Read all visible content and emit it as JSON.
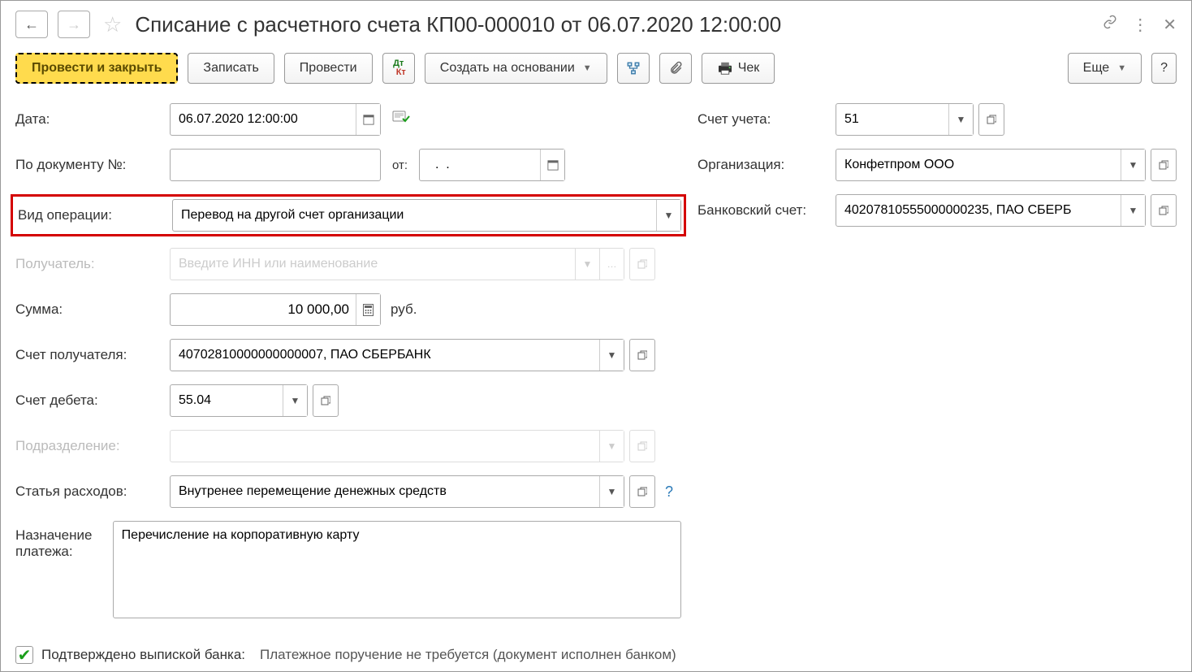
{
  "title": "Списание с расчетного счета КП00-000010 от 06.07.2020 12:00:00",
  "toolbar": {
    "post_close": "Провести и закрыть",
    "save": "Записать",
    "post": "Провести",
    "create_based": "Создать на основании",
    "check": "Чек",
    "more": "Еще",
    "help": "?"
  },
  "labels": {
    "date": "Дата:",
    "doc_no": "По документу №:",
    "from": "от:",
    "operation_type": "Вид операции:",
    "recipient": "Получатель:",
    "amount": "Сумма:",
    "currency": "руб.",
    "recipient_account": "Счет получателя:",
    "debit_account": "Счет дебета:",
    "department": "Подразделение:",
    "expense_item": "Статья расходов:",
    "purpose": "Назначение платежа:",
    "accounting_account": "Счет учета:",
    "organization": "Организация:",
    "bank_account": "Банковский счет:"
  },
  "values": {
    "date": "06.07.2020 12:00:00",
    "doc_no": "",
    "doc_from": "  .  .    ",
    "operation_type": "Перевод на другой счет организации",
    "recipient_placeholder": "Введите ИНН или наименование",
    "amount": "10 000,00",
    "recipient_account": "40702810000000000007, ПАО СБЕРБАНК",
    "debit_account": "55.04",
    "department": "",
    "expense_item": "Внутренее перемещение денежных средств",
    "purpose": "Перечисление на корпоративную карту",
    "accounting_account": "51",
    "organization": "Конфетпром ООО",
    "bank_account": "40207810555000000235, ПАО СБЕРБ"
  },
  "footer": {
    "confirmed": "Подтверждено выпиской банка:",
    "note": "Платежное поручение не требуется (документ исполнен банком)"
  }
}
